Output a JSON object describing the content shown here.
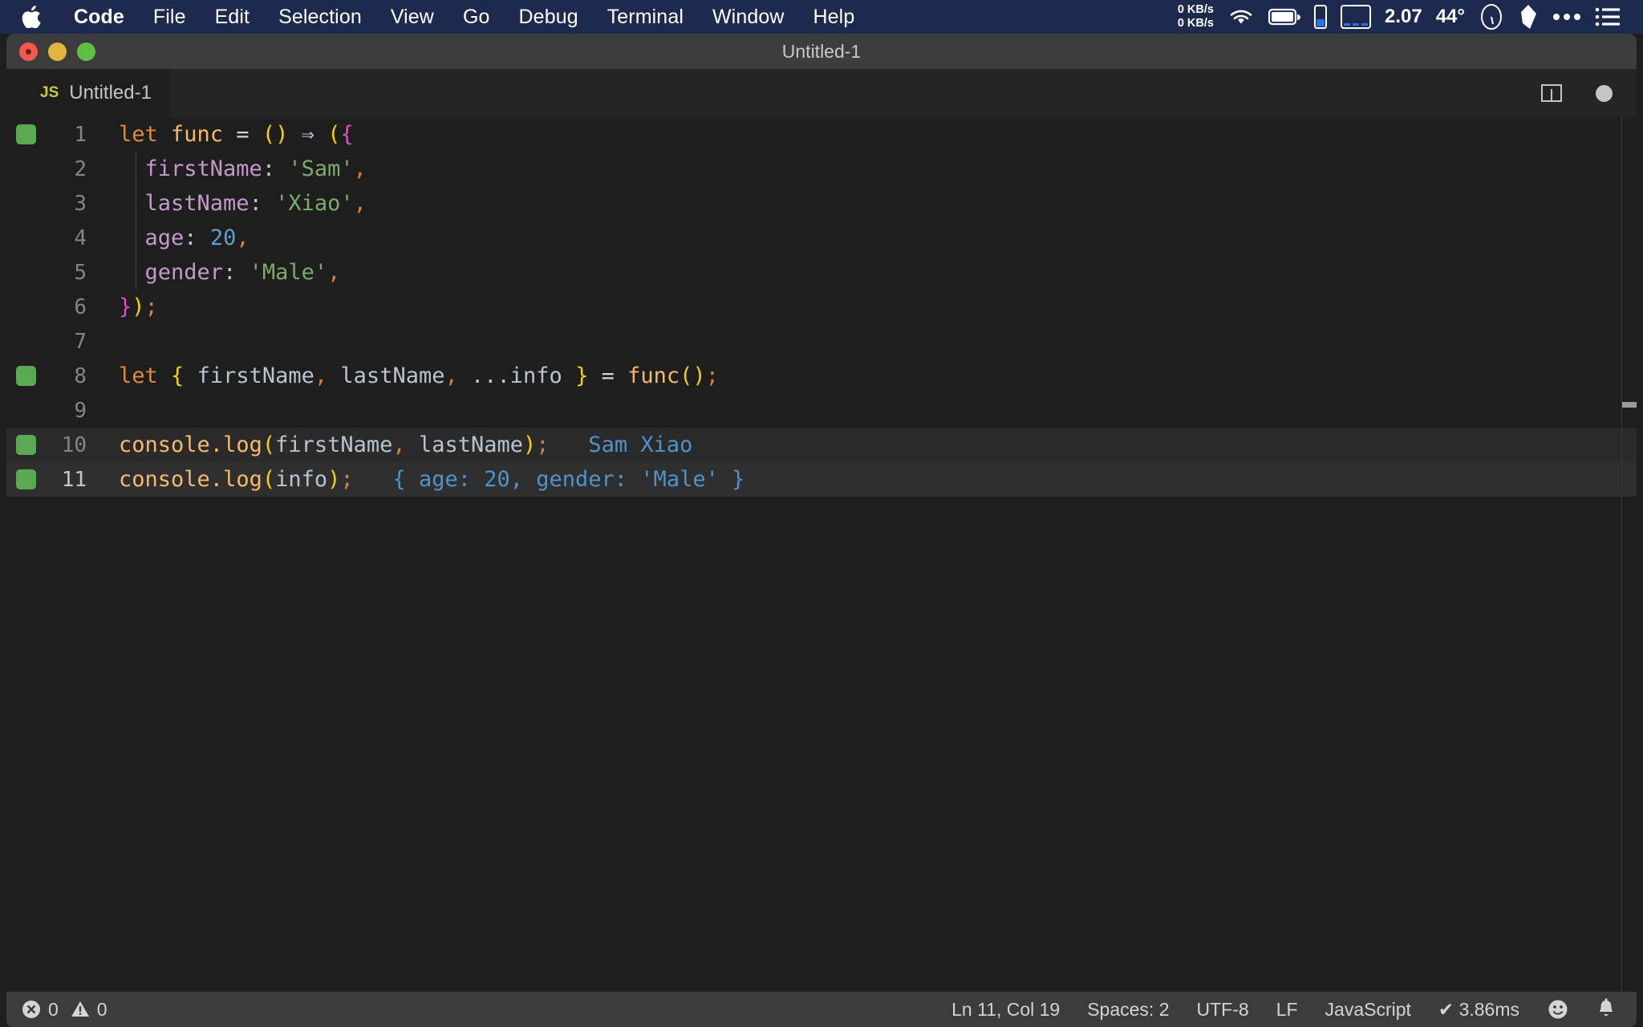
{
  "menubar": {
    "apple_icon": "apple-logo-icon",
    "items": [
      {
        "label": "Code",
        "bold": true
      },
      {
        "label": "File",
        "bold": false
      },
      {
        "label": "Edit",
        "bold": false
      },
      {
        "label": "Selection",
        "bold": false
      },
      {
        "label": "View",
        "bold": false
      },
      {
        "label": "Go",
        "bold": false
      },
      {
        "label": "Debug",
        "bold": false
      },
      {
        "label": "Terminal",
        "bold": false
      },
      {
        "label": "Window",
        "bold": false
      },
      {
        "label": "Help",
        "bold": false
      }
    ],
    "status": {
      "net_down": "0 KB/s",
      "net_up": "0 KB/s",
      "wifi_icon": "wifi-icon",
      "battery_icon": "battery-icon",
      "memory_icon": "memory-gauge-icon",
      "cpu_icon": "cpu-graph-icon",
      "load_value": "2.07",
      "temperature": "44°",
      "clock_icon": "clock-icon",
      "shard_icon": "shard-icon",
      "overflow_icon": "ellipsis-icon",
      "list_icon": "list-icon"
    }
  },
  "window": {
    "title": "Untitled-1",
    "traffic": {
      "close": "close-button",
      "minimize": "minimize-button",
      "maximize": "maximize-button"
    }
  },
  "tabs": {
    "active": {
      "badge": "JS",
      "label": "Untitled-1"
    },
    "actions": {
      "split_editor": "split-editor-icon",
      "unsaved_indicator": "unsaved-dot-icon"
    }
  },
  "editor": {
    "language": "JavaScript",
    "lines": [
      {
        "num": "1",
        "marker": true,
        "indent_guide": false,
        "highlight": false,
        "tokens": [
          {
            "text": "let",
            "cls": "t-key"
          },
          {
            "text": " ",
            "cls": "t-op"
          },
          {
            "text": "func",
            "cls": "t-func"
          },
          {
            "text": " ",
            "cls": "t-op"
          },
          {
            "text": "=",
            "cls": "t-op"
          },
          {
            "text": " ",
            "cls": "t-op"
          },
          {
            "text": "()",
            "cls": "t-paren"
          },
          {
            "text": " ",
            "cls": "t-op"
          },
          {
            "text": "⇒",
            "cls": "t-arrow"
          },
          {
            "text": " ",
            "cls": "t-op"
          },
          {
            "text": "(",
            "cls": "t-paren"
          },
          {
            "text": "{",
            "cls": "t-brace-p"
          }
        ]
      },
      {
        "num": "2",
        "marker": false,
        "indent_guide": true,
        "highlight": false,
        "tokens": [
          {
            "text": "  ",
            "cls": "t-op"
          },
          {
            "text": "firstName",
            "cls": "t-prop"
          },
          {
            "text": ":",
            "cls": "t-colon"
          },
          {
            "text": " ",
            "cls": "t-op"
          },
          {
            "text": "'Sam'",
            "cls": "t-str"
          },
          {
            "text": ",",
            "cls": "t-comma"
          }
        ]
      },
      {
        "num": "3",
        "marker": false,
        "indent_guide": true,
        "highlight": false,
        "tokens": [
          {
            "text": "  ",
            "cls": "t-op"
          },
          {
            "text": "lastName",
            "cls": "t-prop"
          },
          {
            "text": ":",
            "cls": "t-colon"
          },
          {
            "text": " ",
            "cls": "t-op"
          },
          {
            "text": "'Xiao'",
            "cls": "t-str"
          },
          {
            "text": ",",
            "cls": "t-comma"
          }
        ]
      },
      {
        "num": "4",
        "marker": false,
        "indent_guide": true,
        "highlight": false,
        "tokens": [
          {
            "text": "  ",
            "cls": "t-op"
          },
          {
            "text": "age",
            "cls": "t-prop"
          },
          {
            "text": ":",
            "cls": "t-colon"
          },
          {
            "text": " ",
            "cls": "t-op"
          },
          {
            "text": "20",
            "cls": "t-num"
          },
          {
            "text": ",",
            "cls": "t-comma"
          }
        ]
      },
      {
        "num": "5",
        "marker": false,
        "indent_guide": true,
        "highlight": false,
        "tokens": [
          {
            "text": "  ",
            "cls": "t-op"
          },
          {
            "text": "gender",
            "cls": "t-prop"
          },
          {
            "text": ":",
            "cls": "t-colon"
          },
          {
            "text": " ",
            "cls": "t-op"
          },
          {
            "text": "'Male'",
            "cls": "t-str"
          },
          {
            "text": ",",
            "cls": "t-comma"
          }
        ]
      },
      {
        "num": "6",
        "marker": false,
        "indent_guide": false,
        "highlight": false,
        "tokens": [
          {
            "text": "}",
            "cls": "t-brace-p"
          },
          {
            "text": ")",
            "cls": "t-paren"
          },
          {
            "text": ";",
            "cls": "t-semi"
          }
        ]
      },
      {
        "num": "7",
        "marker": false,
        "indent_guide": false,
        "highlight": false,
        "tokens": []
      },
      {
        "num": "8",
        "marker": true,
        "indent_guide": false,
        "highlight": false,
        "tokens": [
          {
            "text": "let",
            "cls": "t-key"
          },
          {
            "text": " ",
            "cls": "t-op"
          },
          {
            "text": "{",
            "cls": "t-paren"
          },
          {
            "text": " ",
            "cls": "t-op"
          },
          {
            "text": "firstName",
            "cls": "t-var"
          },
          {
            "text": ",",
            "cls": "t-comma"
          },
          {
            "text": " ",
            "cls": "t-op"
          },
          {
            "text": "lastName",
            "cls": "t-var"
          },
          {
            "text": ",",
            "cls": "t-comma"
          },
          {
            "text": " ",
            "cls": "t-op"
          },
          {
            "text": "...",
            "cls": "t-dots"
          },
          {
            "text": "info",
            "cls": "t-var"
          },
          {
            "text": " ",
            "cls": "t-op"
          },
          {
            "text": "}",
            "cls": "t-paren"
          },
          {
            "text": " ",
            "cls": "t-op"
          },
          {
            "text": "=",
            "cls": "t-op"
          },
          {
            "text": " ",
            "cls": "t-op"
          },
          {
            "text": "func",
            "cls": "t-func"
          },
          {
            "text": "()",
            "cls": "t-paren"
          },
          {
            "text": ";",
            "cls": "t-semi"
          }
        ]
      },
      {
        "num": "9",
        "marker": false,
        "indent_guide": false,
        "highlight": false,
        "tokens": []
      },
      {
        "num": "10",
        "marker": true,
        "indent_guide": false,
        "highlight": true,
        "tokens": [
          {
            "text": "console",
            "cls": "t-func"
          },
          {
            "text": ".",
            "cls": "t-func"
          },
          {
            "text": "log",
            "cls": "t-func"
          },
          {
            "text": "(",
            "cls": "t-paren"
          },
          {
            "text": "firstName",
            "cls": "t-var"
          },
          {
            "text": ",",
            "cls": "t-comma"
          },
          {
            "text": " ",
            "cls": "t-op"
          },
          {
            "text": "lastName",
            "cls": "t-var"
          },
          {
            "text": ")",
            "cls": "t-paren"
          },
          {
            "text": ";",
            "cls": "t-semi"
          },
          {
            "text": "   ",
            "cls": "t-op"
          },
          {
            "text": "Sam Xiao",
            "cls": "t-result"
          }
        ]
      },
      {
        "num": "11",
        "marker": true,
        "indent_guide": false,
        "highlight": false,
        "active": true,
        "tokens": [
          {
            "text": "console",
            "cls": "t-func"
          },
          {
            "text": ".",
            "cls": "t-func"
          },
          {
            "text": "log",
            "cls": "t-func"
          },
          {
            "text": "(",
            "cls": "t-paren"
          },
          {
            "text": "info",
            "cls": "t-var"
          },
          {
            "text": ")",
            "cls": "t-paren"
          },
          {
            "text": ";",
            "cls": "t-semi"
          },
          {
            "text": "   ",
            "cls": "t-op"
          },
          {
            "text": "{ age: 20, gender: 'Male' }",
            "cls": "t-result"
          }
        ]
      }
    ]
  },
  "statusbar": {
    "error_icon": "error-icon",
    "error_count": "0",
    "warning_icon": "warning-icon",
    "warning_count": "0",
    "cursor_position": "Ln 11, Col 19",
    "indentation": "Spaces: 2",
    "encoding": "UTF-8",
    "eol": "LF",
    "language": "JavaScript",
    "runtime": "✔ 3.86ms",
    "feedback_icon": "smiley-icon",
    "notifications_icon": "bell-icon"
  },
  "colors": {
    "menubar_bg": "#1d2a4d",
    "titlebar_bg": "#3c3c3c",
    "editor_bg": "#1e1e1e",
    "tabbar_bg": "#252526",
    "statusbar_bg": "#3c3c3c",
    "gutter_marker": "#5aa952",
    "result_text": "#4e93cc",
    "js_badge": "#cbcb41"
  }
}
